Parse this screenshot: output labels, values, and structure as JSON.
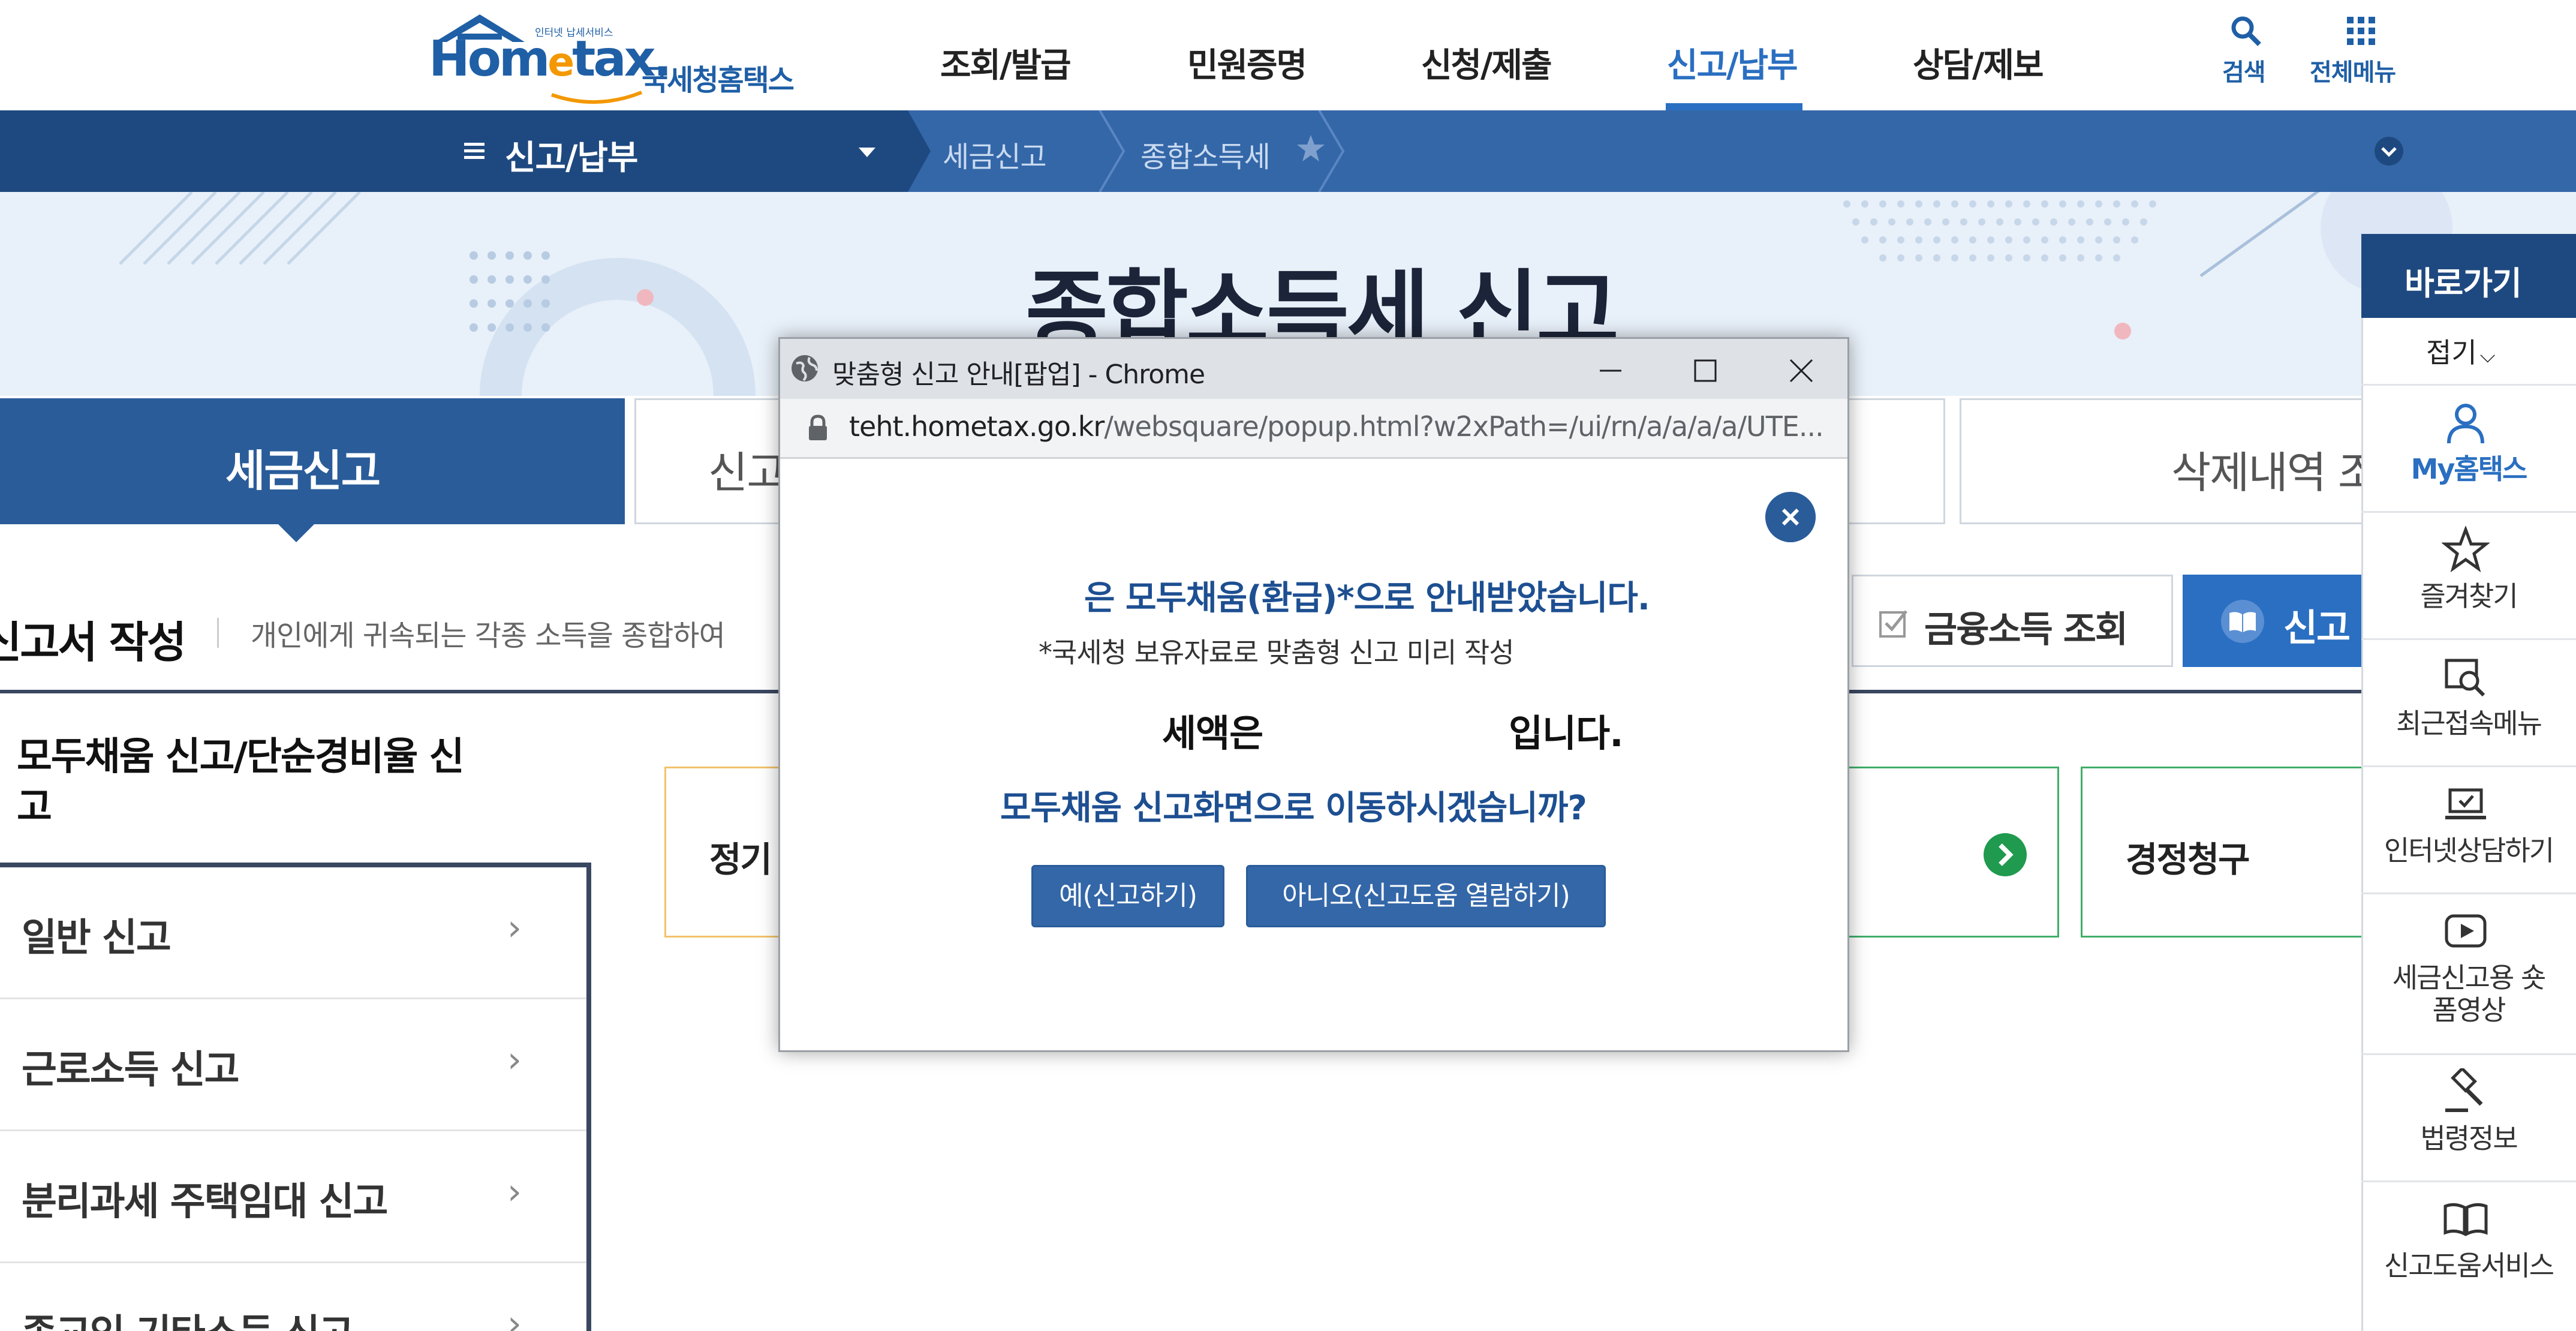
{
  "header": {
    "logo_small": "인터넷 납세서비스",
    "logo_main": "Hom",
    "logo_e": "e",
    "logo_tax": "tax.",
    "logo_kr": "국세청홈택스",
    "nav": [
      "조회/발급",
      "민원증명",
      "신청/제출",
      "신고/납부",
      "상담/제보"
    ],
    "active_nav": "신고/납부",
    "search_label": "검색",
    "allmenu_label": "전체메뉴"
  },
  "breadcrumb": {
    "menu_title": "신고/납부",
    "items": [
      "세금신고",
      "종합소득세"
    ]
  },
  "banner": {
    "title": "종합소득세 신고"
  },
  "tabs": {
    "active": "세금신고",
    "second": "신고",
    "last": "삭제내역 조"
  },
  "section": {
    "title": "신고서 작성",
    "desc": "개인에게 귀속되는 각종 소득을 종합하여 ",
    "finance_btn": "금융소득 조회",
    "help_btn": "신고"
  },
  "left_menu": {
    "title": "모두채움 신고/단순경비율 신고",
    "items": [
      "일반 신고",
      "근로소득 신고",
      "분리과세 주택임대 신고",
      "종교인 기타소득 신고"
    ]
  },
  "cards": {
    "first": "정기",
    "last": "경정청구"
  },
  "sidebar": {
    "header": "바로가기",
    "fold": "접기",
    "items": [
      "My홈택스",
      "즐겨찾기",
      "최근접속메뉴",
      "인터넷상담하기",
      "세금신고용 숏폼영상",
      "법령정보",
      "신고도움서비스"
    ]
  },
  "popup": {
    "window_title": "맞춤형 신고 안내[팝업] - Chrome",
    "url_host": "teht.hometax.go.kr",
    "url_path": "/websquare/popup.html?w2xPath=/ui/rn/a/a/a/a/UTE...",
    "line1": "은 모두채움(환급)*으로 안내받았습니다.",
    "line2": "*국세청 보유자료로 맞춤형 신고 미리 작성",
    "line3a": "세액은",
    "line3b": "입니다.",
    "line4": "모두채움 신고화면으로 이동하시겠습니까?",
    "yes_button": "예(신고하기)",
    "no_button": "아니오(신고도움 열람하기)"
  },
  "colors": {
    "brand_blue": "#1f5fa6",
    "nav_active": "#2a6fc1",
    "bar_dark": "#1e4980",
    "bar_mid": "#3467a8",
    "popup_text": "#1d4f91"
  }
}
